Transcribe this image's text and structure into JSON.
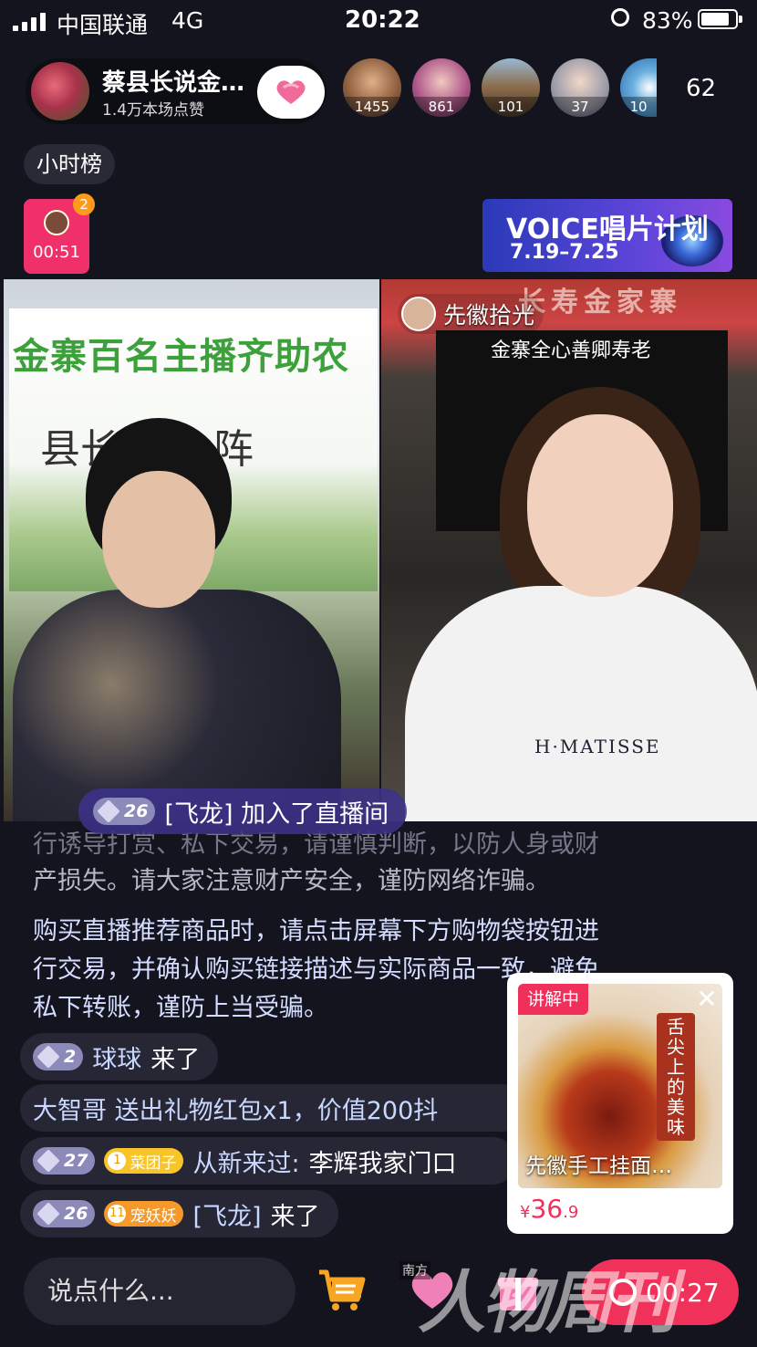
{
  "status_bar": {
    "carrier": "中国联通",
    "network": "4G",
    "time": "20:22",
    "battery": "83%",
    "battery_level": 0.83
  },
  "host": {
    "name": "蔡县长说金…",
    "likes": "1.4万本场点赞"
  },
  "viewers": [
    {
      "score": "1455",
      "color": "#c98a5a"
    },
    {
      "score": "861",
      "color": "#b05a8a"
    },
    {
      "score": "101",
      "color": "#8a6a4a"
    },
    {
      "score": "37",
      "color": "#6a6a7a"
    },
    {
      "score": "10",
      "color": "#3a8ac8"
    }
  ],
  "viewer_count": "62",
  "rank_label": "小时榜",
  "red_packet": {
    "count": "2",
    "timer": "00:51"
  },
  "banner": {
    "title": "VOICE唱片计划",
    "dates": "7.19–7.25"
  },
  "video_left": {
    "board_title": "金寨百名主播齐助农",
    "board_sub": "县长    齐上阵"
  },
  "video_right": {
    "top_sign": "长寿金家寨",
    "shelf_text": "金寨全心善卿寿老",
    "shirt_text": "H·MATISSE",
    "guest_name": "先徽拾光"
  },
  "join_notice": {
    "level": "26",
    "text": "[飞龙] 加入了直播间"
  },
  "notice": {
    "line1": "行诱导打赏、私下交易，请谨慎判断，以防人身或财",
    "line2": "产损失。请大家注意财产安全，谨防网络诈骗。"
  },
  "system_msg": {
    "line1": "购买直播推荐商品时，请点击屏幕下方购物袋按钮进",
    "line2": "行交易，并确认购买链接描述与实际商品一致，避免",
    "line3": "私下转账，谨防上当受骗。"
  },
  "chat": [
    {
      "level": "2",
      "user": "球球",
      "text": "来了"
    },
    {
      "text": "大智哥 送出礼物红包x1，价值200抖"
    },
    {
      "level": "27",
      "fan_level": "1",
      "fan_name": "菜团子",
      "user": "从新来过:",
      "text": "李辉我家门口"
    },
    {
      "level": "26",
      "fan_level": "11",
      "fan_name": "宠妖妖",
      "user": "[飞龙]",
      "text": "来了"
    }
  ],
  "product": {
    "tag": "讲解中",
    "vertical_text": "舌尖上的美味",
    "name": "先徽手工挂面…",
    "currency": "¥",
    "price_int": "36",
    "price_dec": ".9"
  },
  "bottom": {
    "input_placeholder": "说点什么...",
    "timer": "00:27",
    "watermark": "人物周刊",
    "watermark_small": "南方"
  }
}
